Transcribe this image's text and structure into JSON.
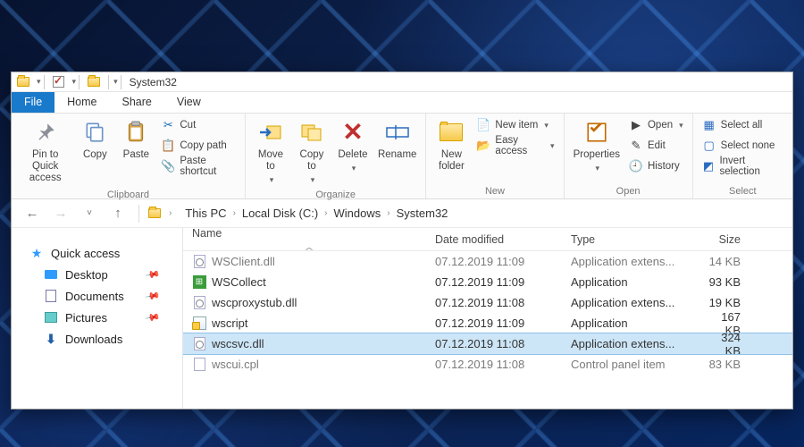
{
  "window": {
    "title": "System32"
  },
  "menu": {
    "file": "File",
    "home": "Home",
    "share": "Share",
    "view": "View"
  },
  "ribbon": {
    "clipboard": {
      "caption": "Clipboard",
      "pin": "Pin to Quick\naccess",
      "copy": "Copy",
      "paste": "Paste",
      "cut": "Cut",
      "copy_path": "Copy path",
      "paste_shortcut": "Paste shortcut"
    },
    "organize": {
      "caption": "Organize",
      "move_to": "Move\nto",
      "copy_to": "Copy\nto",
      "delete": "Delete",
      "rename": "Rename"
    },
    "new": {
      "caption": "New",
      "new_folder": "New\nfolder",
      "new_item": "New item",
      "easy_access": "Easy access"
    },
    "open": {
      "caption": "Open",
      "properties": "Properties",
      "open": "Open",
      "edit": "Edit",
      "history": "History"
    },
    "select": {
      "caption": "Select",
      "select_all": "Select all",
      "select_none": "Select none",
      "invert": "Invert selection"
    }
  },
  "breadcrumb": {
    "items": [
      "This PC",
      "Local Disk (C:)",
      "Windows",
      "System32"
    ]
  },
  "nav": {
    "quick_access": "Quick access",
    "desktop": "Desktop",
    "documents": "Documents",
    "pictures": "Pictures",
    "downloads": "Downloads"
  },
  "columns": {
    "name": "Name",
    "date": "Date modified",
    "type": "Type",
    "size": "Size"
  },
  "files": [
    {
      "name": "WSClient.dll",
      "date": "07.12.2019 11:09",
      "type": "Application extens...",
      "size": "14 KB",
      "icon": "gear",
      "cut": true
    },
    {
      "name": "WSCollect",
      "date": "07.12.2019 11:09",
      "type": "Application",
      "size": "93 KB",
      "icon": "green"
    },
    {
      "name": "wscproxystub.dll",
      "date": "07.12.2019 11:08",
      "type": "Application extens...",
      "size": "19 KB",
      "icon": "gear"
    },
    {
      "name": "wscript",
      "date": "07.12.2019 11:09",
      "type": "Application",
      "size": "167 KB",
      "icon": "script"
    },
    {
      "name": "wscsvc.dll",
      "date": "07.12.2019 11:08",
      "type": "Application extens...",
      "size": "324 KB",
      "icon": "gear",
      "selected": true
    },
    {
      "name": "wscui.cpl",
      "date": "07.12.2019 11:08",
      "type": "Control panel item",
      "size": "83 KB",
      "icon": "cpl",
      "cut": true
    }
  ]
}
